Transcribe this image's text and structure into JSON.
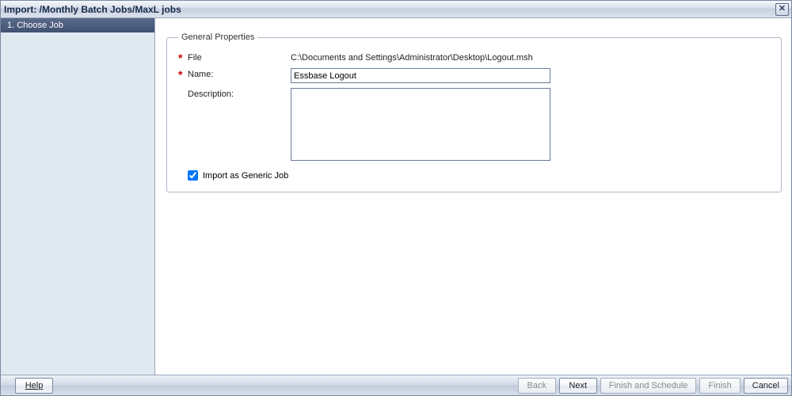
{
  "titlebar": {
    "title": "Import: /Monthly Batch Jobs/MaxL jobs",
    "close_glyph": "✕"
  },
  "sidebar": {
    "steps": [
      {
        "label": "1. Choose Job"
      }
    ]
  },
  "general": {
    "legend": "General Properties",
    "file_label": "File",
    "file_value": "C:\\Documents and Settings\\Administrator\\Desktop\\Logout.msh",
    "name_label": "Name:",
    "name_value": "Essbase Logout",
    "description_label": "Description:",
    "description_value": "",
    "import_generic_label": "Import as Generic Job",
    "import_generic_checked": true
  },
  "footer": {
    "help": "Help",
    "back": "Back",
    "next": "Next",
    "finish_schedule": "Finish and Schedule",
    "finish": "Finish",
    "cancel": "Cancel"
  }
}
